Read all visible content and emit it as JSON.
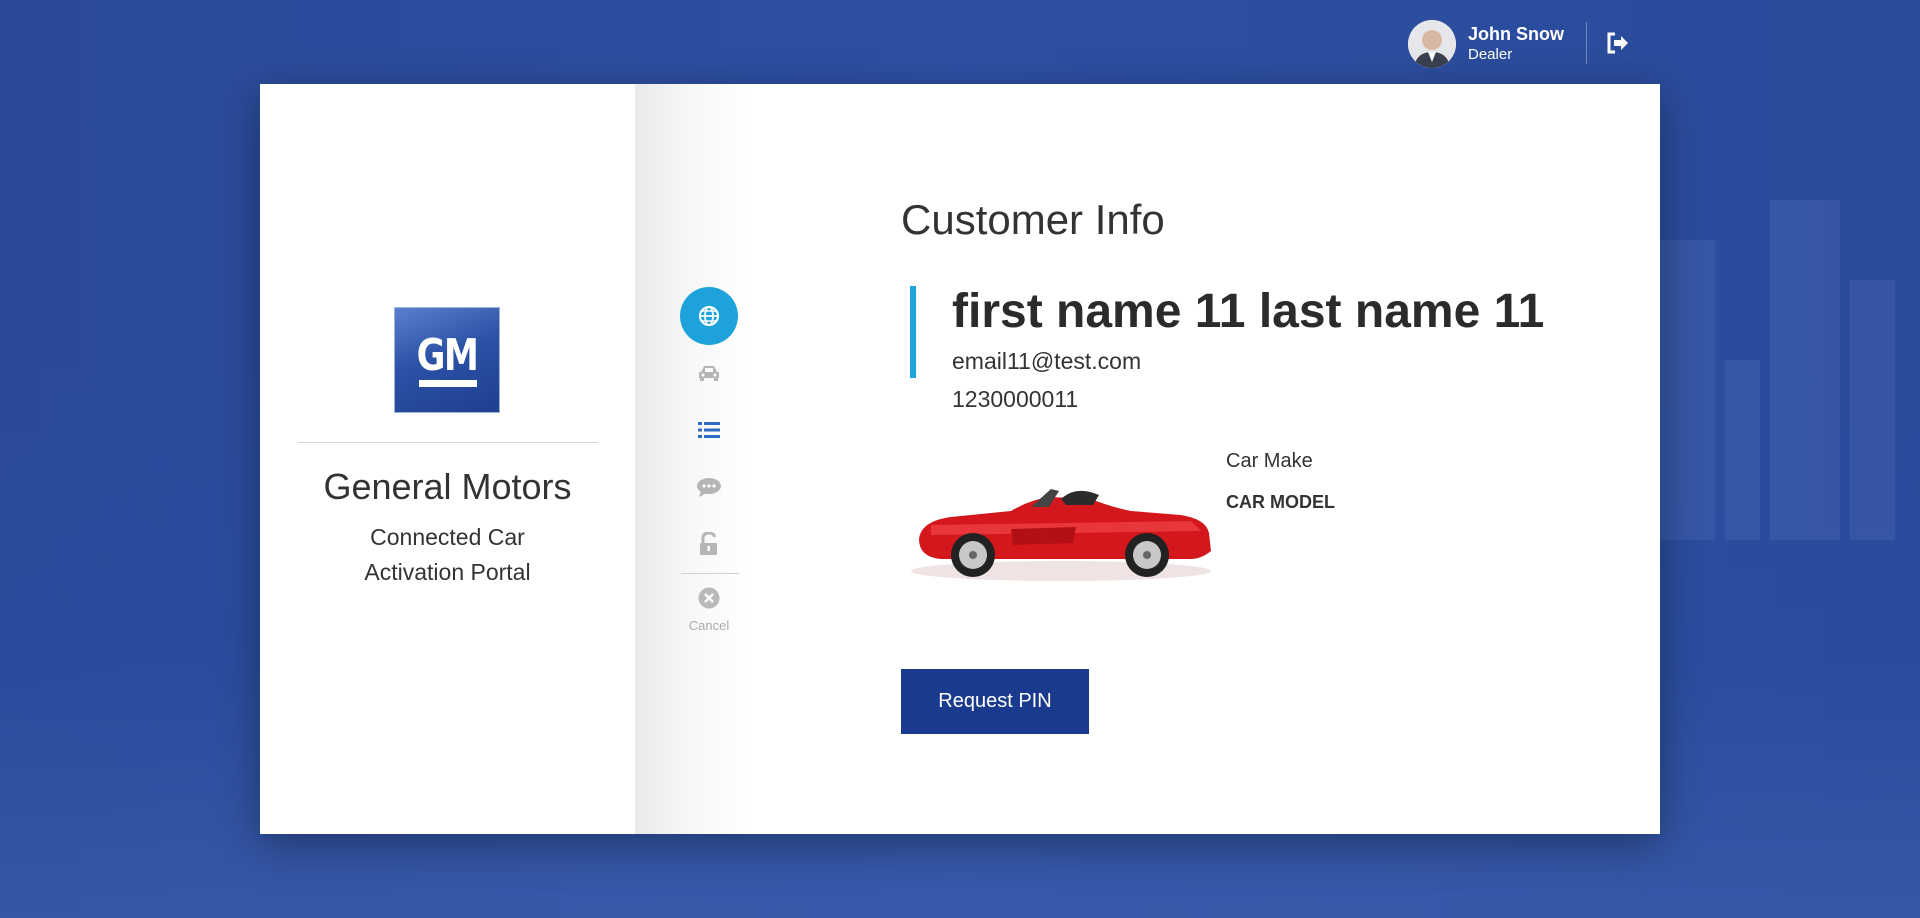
{
  "header": {
    "user_name": "John Snow",
    "user_role": "Dealer",
    "avatar_icon": "user-avatar",
    "logout_icon": "sign-out-icon"
  },
  "brand": {
    "logo_text": "GM",
    "company_name": "General Motors",
    "subtitle_line1": "Connected Car",
    "subtitle_line2": "Activation Portal"
  },
  "steps": [
    {
      "icon": "globe-icon",
      "active": true
    },
    {
      "icon": "car-icon",
      "active": false
    },
    {
      "icon": "list-icon",
      "active": false
    },
    {
      "icon": "chat-icon",
      "active": false
    },
    {
      "icon": "unlock-icon",
      "active": false
    }
  ],
  "cancel": {
    "label": "Cancel",
    "icon": "close-circle-icon"
  },
  "customer": {
    "section_title": "Customer Info",
    "name": "first name 11 last name 11",
    "email": "email11@test.com",
    "phone": "1230000011"
  },
  "vehicle": {
    "make": "Car Make",
    "model": "CAR MODEL"
  },
  "actions": {
    "request_pin_label": "Request PIN"
  },
  "colors": {
    "background": "#2d50a3",
    "accent": "#1ea2dc",
    "primary_button": "#1a3a8e"
  }
}
